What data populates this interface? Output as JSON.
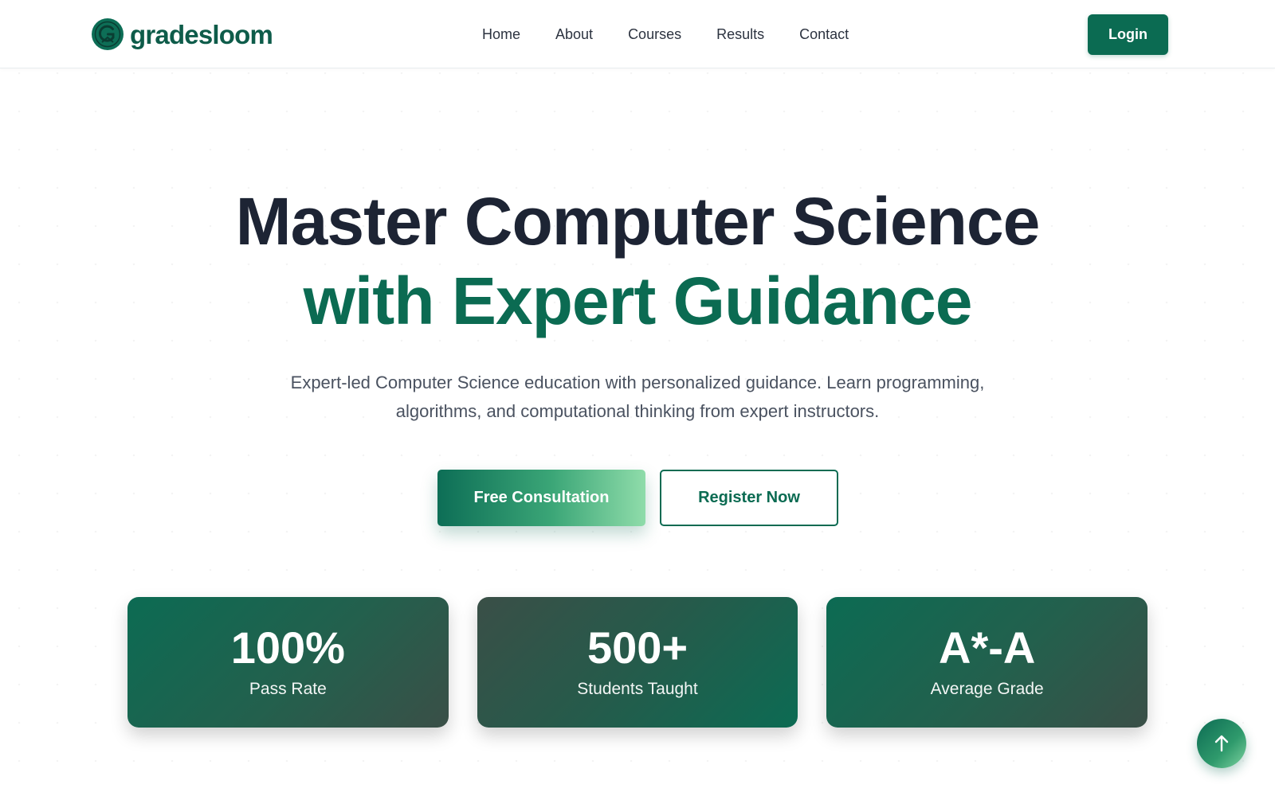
{
  "brand": {
    "name": "gradesloom",
    "logo_icon": "graduation-g-logo",
    "color": "#0b6b52"
  },
  "nav": {
    "items": [
      {
        "label": "Home"
      },
      {
        "label": "About"
      },
      {
        "label": "Courses"
      },
      {
        "label": "Results"
      },
      {
        "label": "Contact"
      }
    ],
    "login_label": "Login"
  },
  "hero": {
    "title_line1": "Master Computer Science",
    "title_line2": "with Expert Guidance",
    "subtitle": "Expert-led Computer Science education with personalized guidance. Learn programming, algorithms, and computational thinking from expert instructors.",
    "primary_cta": "Free Consultation",
    "secondary_cta": "Register Now"
  },
  "stats": [
    {
      "value": "100%",
      "label": "Pass Rate"
    },
    {
      "value": "500+",
      "label": "Students Taught"
    },
    {
      "value": "A*-A",
      "label": "Average Grade"
    }
  ],
  "scroll_top": {
    "icon": "arrow-up-icon"
  },
  "colors": {
    "heading": "#1d2434",
    "accent": "#0b6b52",
    "body_text": "#4a5260"
  }
}
